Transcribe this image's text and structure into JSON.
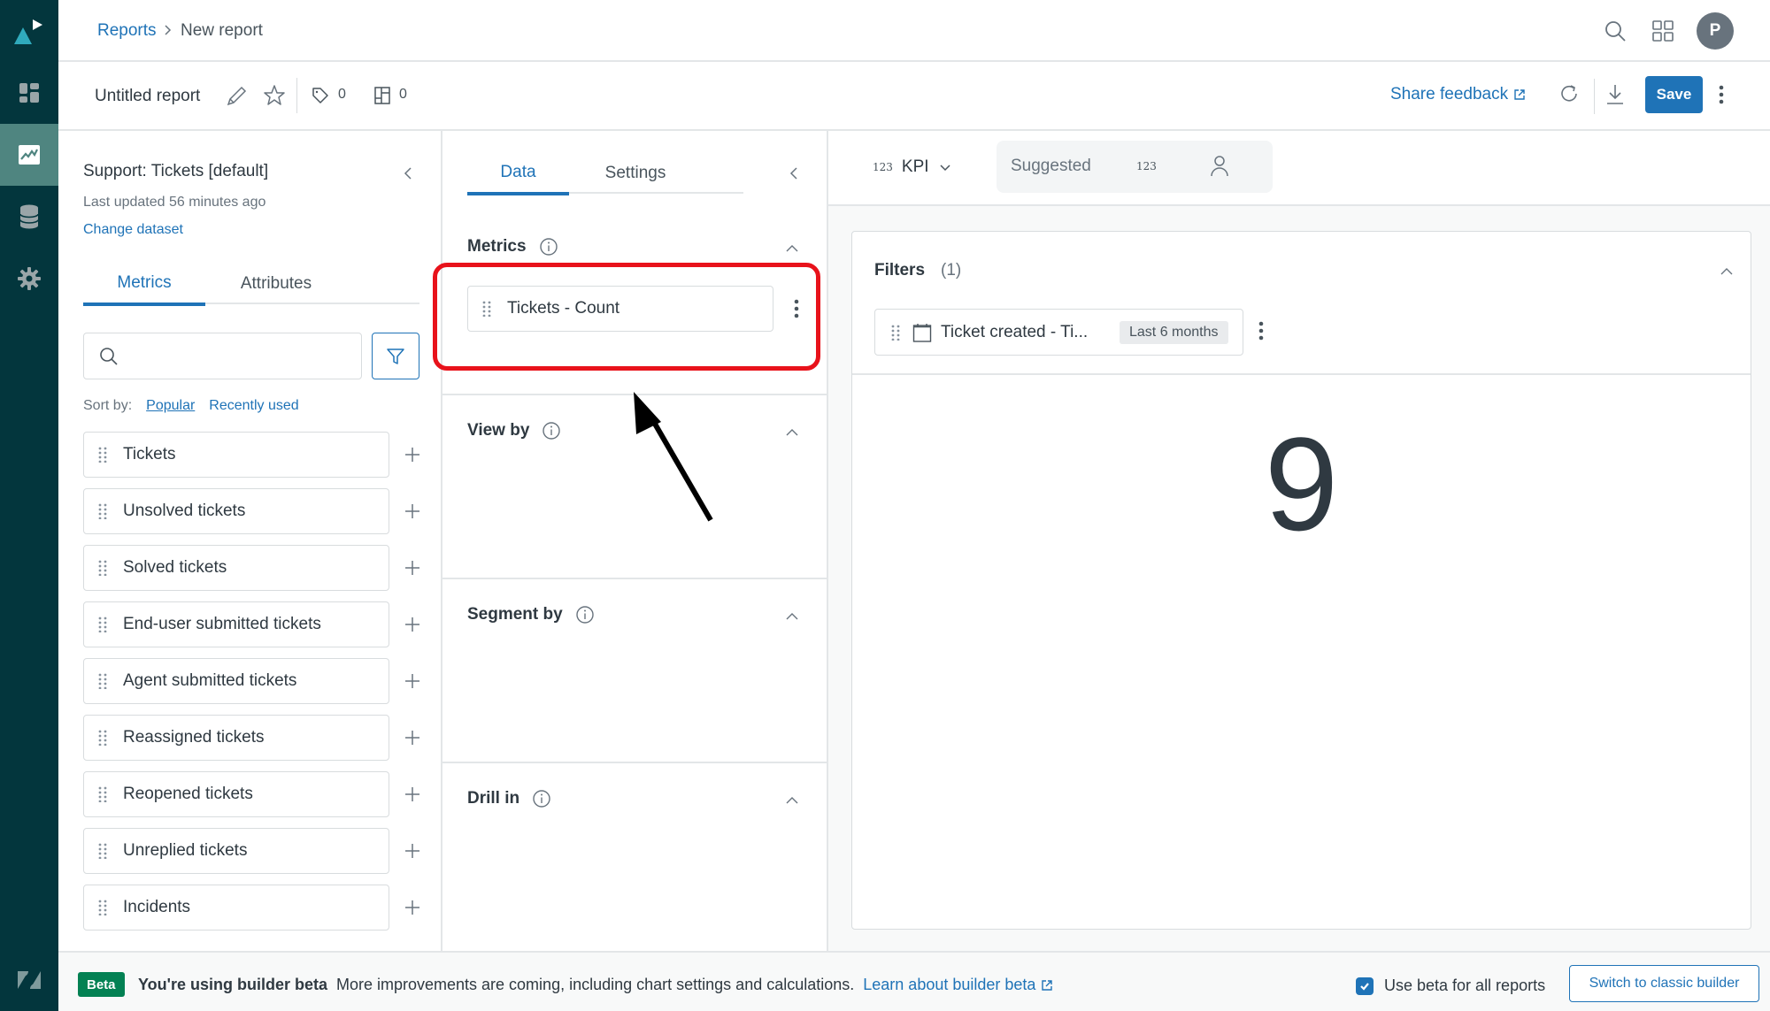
{
  "rail": {
    "items": [
      {
        "icon": "explore-logo-icon"
      },
      {
        "icon": "dashboard-icon"
      },
      {
        "icon": "reports-icon",
        "active": true
      },
      {
        "icon": "datasets-icon"
      },
      {
        "icon": "settings-icon"
      },
      {
        "icon": "zendesk-logo-icon"
      }
    ]
  },
  "header": {
    "breadcrumb": {
      "parent": "Reports",
      "separator": ">",
      "current": "New report"
    },
    "avatar_initial": "P"
  },
  "toolbar": {
    "title": "Untitled report",
    "tags_count": "0",
    "dashboards_count": "0",
    "share_feedback": "Share feedback",
    "save_label": "Save"
  },
  "dataset_panel": {
    "title": "Support: Tickets [default]",
    "last_updated": "Last updated 56 minutes ago",
    "change_dataset": "Change dataset",
    "tabs": [
      {
        "label": "Metrics",
        "active": true
      },
      {
        "label": "Attributes",
        "active": false
      }
    ],
    "search": {
      "value": "",
      "placeholder": ""
    },
    "sort_by_label": "Sort by:",
    "sort_options": [
      {
        "label": "Popular",
        "active": true
      },
      {
        "label": "Recently used",
        "active": false
      }
    ],
    "metrics": [
      "Tickets",
      "Unsolved tickets",
      "Solved tickets",
      "End-user submitted tickets",
      "Agent submitted tickets",
      "Reassigned tickets",
      "Reopened tickets",
      "Unreplied tickets",
      "Incidents"
    ]
  },
  "config_panel": {
    "tabs": [
      {
        "label": "Data",
        "active": true
      },
      {
        "label": "Settings",
        "active": false
      }
    ],
    "sections": {
      "metrics": {
        "title": "Metrics",
        "items": [
          "Tickets - Count"
        ]
      },
      "view_by": {
        "title": "View by"
      },
      "segment_by": {
        "title": "Segment by"
      },
      "drill_in": {
        "title": "Drill in"
      }
    }
  },
  "visualization": {
    "chart_type": "KPI",
    "chart_type_glyph": "123",
    "suggested_label": "Suggested",
    "suggested_glyph": "123",
    "filters": {
      "title": "Filters",
      "count": "(1)",
      "items": [
        {
          "label": "Ticket created - Ti...",
          "value": "Last 6 months"
        }
      ]
    },
    "kpi_value": "9"
  },
  "footer": {
    "badge": "Beta",
    "headline": "You're using builder beta",
    "message": "More improvements are coming, including chart settings and calculations.",
    "learn_link": "Learn about builder beta",
    "checkbox_label": "Use beta for all reports",
    "checkbox_checked": true,
    "switch_button": "Switch to classic builder"
  },
  "colors": {
    "accent": "#1f73b7",
    "rail": "#03363d",
    "rail_active": "#4f8580",
    "beta_green": "#038153",
    "annotation_red": "#e8121b"
  }
}
